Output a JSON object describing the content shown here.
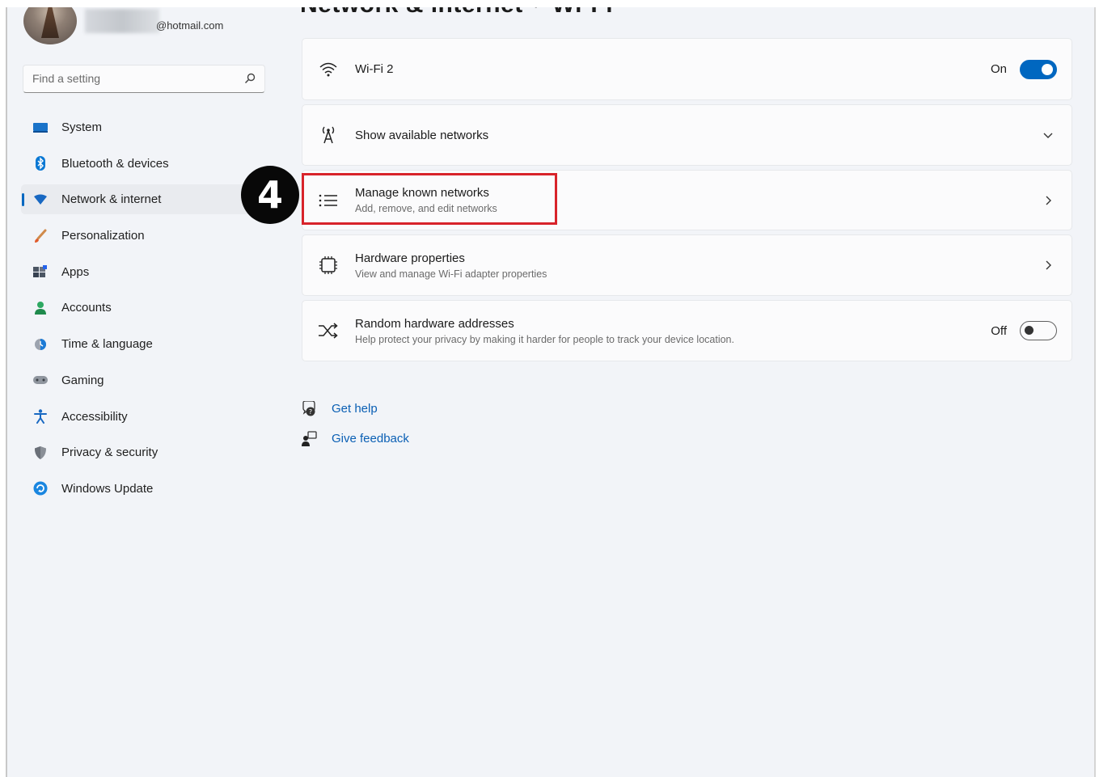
{
  "user": {
    "email": "@hotmail.com"
  },
  "search": {
    "placeholder": "Find a setting"
  },
  "breadcrumb": {
    "parent": "Network & internet",
    "separator": "›",
    "current": "Wi-Fi"
  },
  "sidebar": {
    "items": [
      {
        "label": "System",
        "icon": "system-icon",
        "active": false
      },
      {
        "label": "Bluetooth & devices",
        "icon": "bluetooth-icon",
        "active": false
      },
      {
        "label": "Network & internet",
        "icon": "network-icon",
        "active": true
      },
      {
        "label": "Personalization",
        "icon": "brush-icon",
        "active": false
      },
      {
        "label": "Apps",
        "icon": "apps-icon",
        "active": false
      },
      {
        "label": "Accounts",
        "icon": "person-icon",
        "active": false
      },
      {
        "label": "Time & language",
        "icon": "globe-clock-icon",
        "active": false
      },
      {
        "label": "Gaming",
        "icon": "gamepad-icon",
        "active": false
      },
      {
        "label": "Accessibility",
        "icon": "accessibility-icon",
        "active": false
      },
      {
        "label": "Privacy & security",
        "icon": "shield-icon",
        "active": false
      },
      {
        "label": "Windows Update",
        "icon": "update-icon",
        "active": false
      }
    ]
  },
  "main": {
    "wifi": {
      "title": "Wi-Fi 2",
      "state_label": "On",
      "enabled": true
    },
    "show_networks": {
      "title": "Show available networks"
    },
    "manage_known": {
      "title": "Manage known networks",
      "subtitle": "Add, remove, and edit networks"
    },
    "hardware": {
      "title": "Hardware properties",
      "subtitle": "View and manage Wi-Fi adapter properties"
    },
    "random_hw": {
      "title": "Random hardware addresses",
      "subtitle": "Help protect your privacy by making it harder for people to track your device location.",
      "state_label": "Off",
      "enabled": false
    }
  },
  "links": {
    "get_help": "Get help",
    "give_feedback": "Give feedback"
  },
  "annotation": {
    "step": "4"
  },
  "colors": {
    "accent": "#0067c0",
    "highlight": "#d8232a",
    "link": "#0a5fb4"
  }
}
